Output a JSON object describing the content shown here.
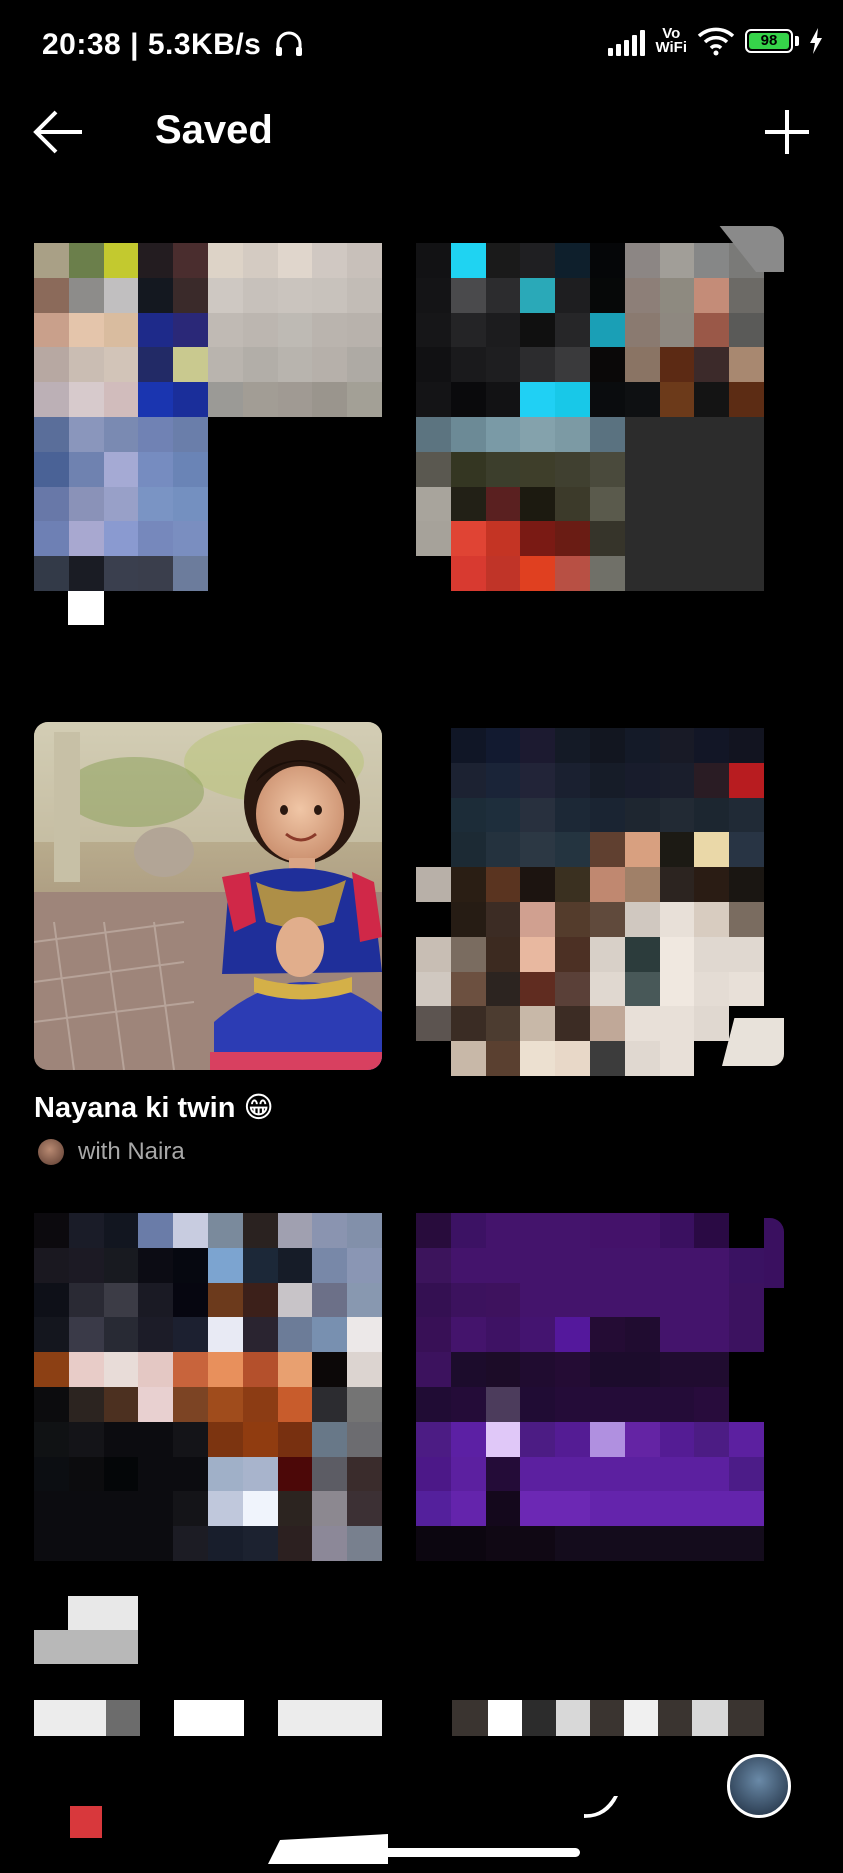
{
  "status_bar": {
    "time": "20:38",
    "speed": "5.3KB/s",
    "network_label_top": "Vo",
    "network_label_bottom": "WiFi",
    "battery": "98"
  },
  "header": {
    "title": "Saved",
    "back_icon": "arrow-left-icon",
    "add_icon": "plus-icon"
  },
  "collections": [
    {
      "kind": "pixelated",
      "colors": [
        "#a9a086",
        "#6b7f4b",
        "#c3c92f",
        "#231c20",
        "#4a2d2e",
        "#ddd3c7",
        "#d4cbc2",
        "#e0d6cc",
        "#d0c8c2",
        "#c8c0ba",
        "#8b6a5a",
        "#8d8c8a",
        "#c1bfc0",
        "#141820",
        "#3a2a2a",
        "#cec8c2",
        "#c7c1bb",
        "#cac4be",
        "#c8c2bc",
        "#c2bcb6",
        "#c9a08b",
        "#e4c5ab",
        "#d9bc9f",
        "#1e2a8a",
        "#2a2878",
        "#c0bab4",
        "#bcb6b0",
        "#bebab4",
        "#bab4ae",
        "#b8b2ac",
        "#b7a8a2",
        "#cabdb3",
        "#d2c4b8",
        "#222a66",
        "#c9c98f",
        "#b9b4ae",
        "#b2aea8",
        "#b8b4ae",
        "#b6b0aa",
        "#aeaaa4",
        "#bcb0b6",
        "#d7cacc",
        "#d1bcbc",
        "#1a35b0",
        "#1a2e9a",
        "#9b9a96",
        "#a29d95",
        "#a09a93",
        "#9a958d",
        "#a3a096",
        "#5a6e9a",
        "#8a96bc",
        "#7a8ab2",
        "#7082b4",
        "#6a7eaa",
        "#000",
        "#000",
        "#000",
        "#000",
        "#000",
        "#4a6296",
        "#6f82b0",
        "#a5aad4",
        "#768cc0",
        "#6a84b6",
        "#000",
        "#000",
        "#000",
        "#000",
        "#000",
        "#6878a8",
        "#8a92b8",
        "#98a0c8",
        "#7a94c4",
        "#7490c0",
        "#000",
        "#000",
        "#000",
        "#000",
        "#000",
        "#6e80b4",
        "#a8a8d0",
        "#8a9ad0",
        "#7688bc",
        "#7a8ec0",
        "#000",
        "#000",
        "#000",
        "#000",
        "#000",
        "#333a48",
        "#1a1c24",
        "#3a3f4e",
        "#3a3e4c",
        "#6c7c9c",
        "#000",
        "#000",
        "#000",
        "#000",
        "#000"
      ]
    },
    {
      "kind": "pixelated",
      "colors": [
        "#121214",
        "#1fd3f2",
        "#1a1a1a",
        "#1f1f22",
        "#0e1f2c",
        "#050608",
        "#8c8684",
        "#a19e98",
        "#868787",
        "#7a7a78",
        "#141416",
        "#4a4a4c",
        "#2c2c2e",
        "#2aa9b8",
        "#1e1e20",
        "#060808",
        "#8d7f78",
        "#8e8a80",
        "#c48c78",
        "#6c6a66",
        "#161618",
        "#242426",
        "#1c1c1e",
        "#101010",
        "#262628",
        "#1a9fb6",
        "#8a7a70",
        "#8e8880",
        "#9a5848",
        "#5a5a58",
        "#111113",
        "#1a1a1c",
        "#1e1e20",
        "#2c2c2e",
        "#3a3a3c",
        "#0a0808",
        "#8a7464",
        "#5c2a14",
        "#3c2a2a",
        "#a88870",
        "#141416",
        "#0a0a0c",
        "#121214",
        "#20d0f4",
        "#18c8e8",
        "#0a0c0e",
        "#0e1012",
        "#6c3a1a",
        "#141414",
        "#5c2c14",
        "#5c7480",
        "#6c8a96",
        "#7a9aa6",
        "#84a2ac",
        "#7c9aa4",
        "#5a7280",
        "#2c2c2c",
        "#2c2c2c",
        "#2c2c2c",
        "#2c2c2c",
        "#5a5850",
        "#343622",
        "#3c3e2c",
        "#3e3e2a",
        "#404030",
        "#4a4a3c",
        "#2c2c2c",
        "#2c2c2c",
        "#2c2c2c",
        "#2c2c2c",
        "#a8a49c",
        "#222016",
        "#5a2020",
        "#1c1a10",
        "#3c3a2a",
        "#5a5a4c",
        "#2c2c2c",
        "#2c2c2c",
        "#2c2c2c",
        "#2c2c2c",
        "#a6a29a",
        "#e04434",
        "#c43424",
        "#7a1a14",
        "#6a1c14",
        "#36342a",
        "#2c2c2c",
        "#2c2c2c",
        "#2c2c2c",
        "#2c2c2c",
        "#000",
        "#d83a30",
        "#c03428",
        "#e04020",
        "#b85044",
        "#707068",
        "#2c2c2c",
        "#2c2c2c",
        "#2c2c2c",
        "#2c2c2c"
      ]
    },
    {
      "kind": "photo",
      "title": "Nayana ki twin 😁",
      "subtitle": "with Naira",
      "avatar_icon": "collaborator-avatar-icon"
    },
    {
      "kind": "pixelated",
      "colors": [
        "#000",
        "#101626",
        "#121a30",
        "#1c1a30",
        "#141a26",
        "#121620",
        "#141a28",
        "#181a26",
        "#121626",
        "#121420",
        "#000",
        "#1c2232",
        "#1a2438",
        "#222438",
        "#1a2030",
        "#161c28",
        "#181c2c",
        "#1a1e2c",
        "#2a1c24",
        "#b81c20",
        "#000",
        "#1c2c38",
        "#1e2e3c",
        "#28303e",
        "#1c2836",
        "#1a2432",
        "#1e2630",
        "#222a34",
        "#1c2630",
        "#202a36",
        "#000",
        "#1c2a34",
        "#24323e",
        "#2c3844",
        "#243440",
        "#604030",
        "#d8a080",
        "#1c1a14",
        "#ead8a8",
        "#283444",
        "#b8b0a8",
        "#2a1e14",
        "#5a3420",
        "#1c1410",
        "#3a3020",
        "#c08870",
        "#a08068",
        "#2c2420",
        "#2a1c14",
        "#1a1612",
        "#000",
        "#261c14",
        "#3c2c24",
        "#d0a090",
        "#543c2c",
        "#604a3c",
        "#d0c8c0",
        "#e8e0d8",
        "#d8ccc0",
        "#7a6c60",
        "#c8beb4",
        "#7a6c60",
        "#3c2a20",
        "#e8b8a0",
        "#4c3024",
        "#d8d0c8",
        "#2c3c3c",
        "#f0e8e0",
        "#e0d8d0",
        "#e0d8d0",
        "#d0c8c0",
        "#6c5040",
        "#2c2420",
        "#602c20",
        "#5a4038",
        "#e0d8d0",
        "#485858",
        "#f0e8e0",
        "#e4dcd4",
        "#e8e0d8",
        "#5c5450",
        "#3a2c24",
        "#4c3c30",
        "#c8b8a8",
        "#3c2c24",
        "#c0a898",
        "#e8e0d8",
        "#e8e0d8",
        "#e0d8d0",
        "#000",
        "#000",
        "#c8b8a8",
        "#5a4030",
        "#ece0d0",
        "#e8d8c8",
        "#3c3c3c",
        "#e0d8d0",
        "#e8e0d8",
        "#000",
        "#000"
      ]
    },
    {
      "kind": "pixelated",
      "colors": [
        "#0c0a0e",
        "#1a1c28",
        "#121620",
        "#6a7ca8",
        "#c8cce0",
        "#7a8a9c",
        "#2a2220",
        "#a0a0b0",
        "#8a94b0",
        "#8290aa",
        "#1a1820",
        "#1c1a24",
        "#181a20",
        "#0c0c14",
        "#060810",
        "#7ca4d0",
        "#1c2838",
        "#161c28",
        "#7888a8",
        "#8a96b4",
        "#0e1018",
        "#2a2a34",
        "#3c3c46",
        "#1a1a24",
        "#060610",
        "#6c3a1c",
        "#3c201a",
        "#c8c4c8",
        "#6c7088",
        "#8898b0",
        "#14161e",
        "#3a3a48",
        "#282a34",
        "#1c1c28",
        "#1c2030",
        "#e8eaf4",
        "#2a2430",
        "#6c7c98",
        "#7890b0",
        "#ece8e8",
        "#8c4014",
        "#e8ccc8",
        "#e8dcd8",
        "#e4c8c4",
        "#c8643c",
        "#e8905c",
        "#b4502c",
        "#e8a070",
        "#0c0808",
        "#dcd4d0",
        "#0c0c0e",
        "#2c2420",
        "#4c3020",
        "#e8d0d0",
        "#7c4424",
        "#a04c1c",
        "#8c3c14",
        "#c85c2c",
        "#2c2c30",
        "#747474",
        "#101214",
        "#141418",
        "#0c0c10",
        "#0c0c10",
        "#141418",
        "#7c3410",
        "#903c10",
        "#783010",
        "#687888",
        "#6c6c70",
        "#0c0e12",
        "#0c0c0e",
        "#040608",
        "#0c0c10",
        "#0c0c10",
        "#a0b0c8",
        "#a8b4cc",
        "#4c0808",
        "#5c5c64",
        "#3a2c2c",
        "#0c0c10",
        "#0c0c10",
        "#0c0c10",
        "#0c0c10",
        "#141418",
        "#c0c8dc",
        "#f0f4fc",
        "#2c2420",
        "#8c8890",
        "#3c3034",
        "#0c0c10",
        "#0c0c10",
        "#0c0c10",
        "#0c0c10",
        "#1c1c24",
        "#181e2c",
        "#1c2230",
        "#2c2020",
        "#8c8898",
        "#78808e"
      ]
    },
    {
      "kind": "pixelated",
      "colors": [
        "#280c3c",
        "#3c1264",
        "#44146c",
        "#44146c",
        "#44146c",
        "#44126a",
        "#44126a",
        "#3a1060",
        "#2a0a44",
        "#000",
        "#3c145c",
        "#44146c",
        "#44146c",
        "#44146c",
        "#44146c",
        "#44146c",
        "#44146c",
        "#44146c",
        "#44146c",
        "#3a1262",
        "#341052",
        "#3c125e",
        "#3e125e",
        "#44146c",
        "#44146c",
        "#44146c",
        "#44146c",
        "#44146c",
        "#44146c",
        "#3c1260",
        "#381056",
        "#44146c",
        "#3e1264",
        "#441470",
        "#54189c",
        "#240c34",
        "#200c30",
        "#44146c",
        "#44146c",
        "#3c1260",
        "#3c125e",
        "#1c0c2c",
        "#1c0c28",
        "#200c30",
        "#240c34",
        "#1c0c2c",
        "#1c0c2c",
        "#200c30",
        "#200c30",
        "#000",
        "#200c34",
        "#240c38",
        "#4c3c5c",
        "#200c34",
        "#240c38",
        "#240c38",
        "#240c38",
        "#240c38",
        "#280c3c",
        "#000",
        "#4c1c84",
        "#5c20a4",
        "#e0c8f8",
        "#4c1c84",
        "#541c94",
        "#b090e0",
        "#6424a4",
        "#541c94",
        "#4c1c84",
        "#5c20a0",
        "#4c1888",
        "#5c20a0",
        "#240c38",
        "#5c20a0",
        "#5c20a0",
        "#5c20a0",
        "#5c20a0",
        "#5c20a0",
        "#5c20a0",
        "#4c1c88",
        "#54209c",
        "#6424ac",
        "#14081c",
        "#6c28b4",
        "#6c28b4",
        "#6424ac",
        "#6424ac",
        "#6424ac",
        "#6424ac",
        "#6424ac",
        "#0c0610",
        "#0c0610",
        "#100814",
        "#100814",
        "#140c1c",
        "#140c1c",
        "#140c1c",
        "#140c1c",
        "#140c1c",
        "#140c1c"
      ]
    }
  ],
  "bottom_nav": {
    "home_icon": "home-icon",
    "reels_icon": "reels-icon",
    "profile_icon": "profile-avatar-icon"
  }
}
